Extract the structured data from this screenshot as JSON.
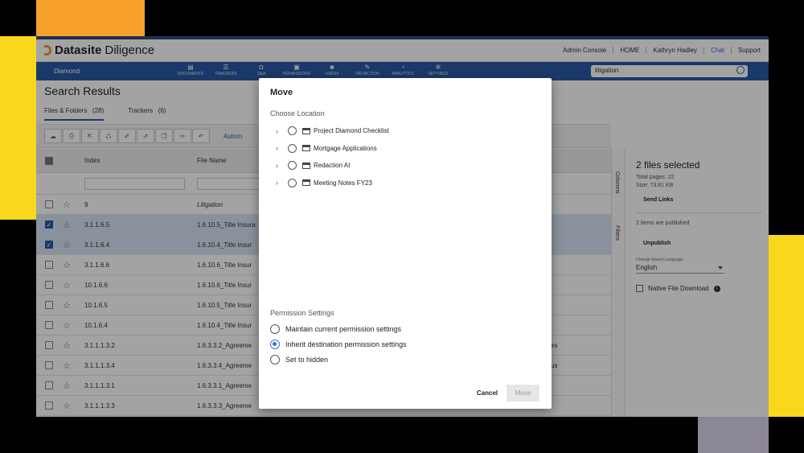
{
  "topbar": {
    "brand": "Datasite",
    "product": "Diligence",
    "links": [
      "Admin Console",
      "HOME",
      "Kathryn Hadley",
      "Chat",
      "Support"
    ]
  },
  "bluebar": {
    "project": "Diamond",
    "nav": [
      "DOCUMENTS",
      "TRACKERS",
      "Q&A",
      "PERMISSIONS",
      "USERS",
      "REDACTION",
      "ANALYTICS",
      "SETTINGS"
    ],
    "search_value": "litigation"
  },
  "page": {
    "title": "Search Results",
    "tabs": [
      {
        "label": "Files & Folders",
        "count": "(28)"
      },
      {
        "label": "Trackers",
        "count": "(6)"
      }
    ],
    "toolbar_automate": "Autom"
  },
  "table": {
    "headers": {
      "index": "Index",
      "file_name": "File Name"
    },
    "rows": [
      {
        "index": "9",
        "name": "Litigation",
        "selected": false,
        "extra": ""
      },
      {
        "index": "3.1.1.6.5",
        "name": "1.6.10.5_Title Insura",
        "selected": true,
        "extra": ""
      },
      {
        "index": "3.1.1.6.4",
        "name": "1.6.10.4_Title Insur",
        "selected": true,
        "extra": ""
      },
      {
        "index": "3.1.1.6.6",
        "name": "1.6.10.6_Title Insur",
        "selected": false,
        "extra": ""
      },
      {
        "index": "10.1.6.6",
        "name": "1.6.10.6_Title Insur",
        "selected": false,
        "extra": ""
      },
      {
        "index": "10.1.6.5",
        "name": "1.6.10.5_Title Insur",
        "selected": false,
        "extra": ""
      },
      {
        "index": "10.1.6.4",
        "name": "1.6.10.4_Title Insur",
        "selected": false,
        "extra": ""
      },
      {
        "index": "3.1.1.1.3.2",
        "name": "1.6.3.3.2_Agreeme",
        "selected": false,
        "extra": "es"
      },
      {
        "index": "3.1.1.1.3.4",
        "name": "1.6.3.3.4_Agreeme",
        "selected": false,
        "extra": "us"
      },
      {
        "index": "3.1.1.1.3.1",
        "name": "1.6.3.3.1_Agreeme",
        "selected": false,
        "extra": ""
      },
      {
        "index": "3.1.1.1.3.3",
        "name": "1.6.3.3.3_Agreeme",
        "selected": false,
        "extra": ""
      }
    ]
  },
  "sidetabs": [
    "Columns",
    "Filters"
  ],
  "right_panel": {
    "title": "2 files selected",
    "total_pages": "Total pages: 22",
    "size": "Size: 73.81 KB",
    "send_links": "Send Links",
    "published": "2 items are published",
    "unpublish": "Unpublish",
    "lang_label": "Change Search Language",
    "lang_value": "English",
    "native_download": "Native File Download"
  },
  "modal": {
    "title": "Move",
    "choose_location": "Choose Location",
    "locations": [
      "Project Diamond Checklist",
      "Mortgage Applications",
      "Redaction AI",
      "Meeting Notes FY23"
    ],
    "permission_title": "Permission Settings",
    "permissions": [
      {
        "label": "Maintain current permission settings",
        "selected": false
      },
      {
        "label": "Inherit destination permission settings",
        "selected": true
      },
      {
        "label": "Set to hidden",
        "selected": false
      }
    ],
    "cancel": "Cancel",
    "move": "Move"
  },
  "colors": {
    "brand_blue": "#2a5aa6",
    "brand_orange": "#f29b33",
    "radio_active": "#3b6fd6"
  }
}
